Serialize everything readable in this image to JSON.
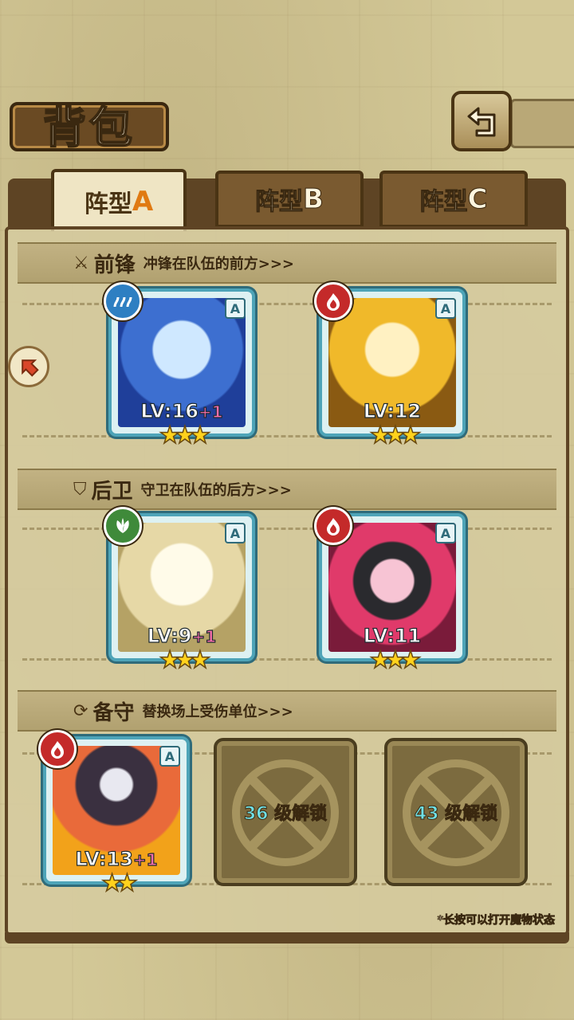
{
  "header": {
    "title": "背包",
    "back_icon": "back-arrow-icon"
  },
  "tabs": [
    {
      "prefix": "阵型",
      "letter": "A",
      "active": true
    },
    {
      "prefix": "阵型",
      "letter": "B",
      "active": false
    },
    {
      "prefix": "阵型",
      "letter": "C",
      "active": false
    }
  ],
  "sections": {
    "front": {
      "icon": "sword-icon",
      "name": "前锋",
      "desc": "冲锋在队伍的前方>>>"
    },
    "rear": {
      "icon": "shield-icon",
      "name": "后卫",
      "desc": "守卫在队伍的后方>>>"
    },
    "reserve": {
      "icon": "swap-icon",
      "name": "备守",
      "desc": "替换场上受伤单位>>>"
    }
  },
  "units": {
    "front_1": {
      "element": "water",
      "rank": "A",
      "level": "LV:16",
      "bonus": "+1",
      "stars": 3
    },
    "front_2": {
      "element": "fire",
      "rank": "A",
      "level": "LV:12",
      "bonus": "",
      "stars": 3
    },
    "rear_1": {
      "element": "leaf",
      "rank": "A",
      "level": "LV:9",
      "bonus": "+1",
      "stars": 3
    },
    "rear_2": {
      "element": "fire",
      "rank": "A",
      "level": "LV:11",
      "bonus": "",
      "stars": 3
    },
    "reserve_1": {
      "element": "fire",
      "rank": "A",
      "level": "LV:13",
      "bonus": "+1",
      "stars": 2
    }
  },
  "locked_slots": [
    {
      "level": "36",
      "label": "级解锁"
    },
    {
      "level": "43",
      "label": "级解锁"
    }
  ],
  "footer": {
    "hint": "*长按可以打开魔物状态"
  },
  "stars_glyph": {
    "three": "★★★",
    "two": "★★"
  }
}
